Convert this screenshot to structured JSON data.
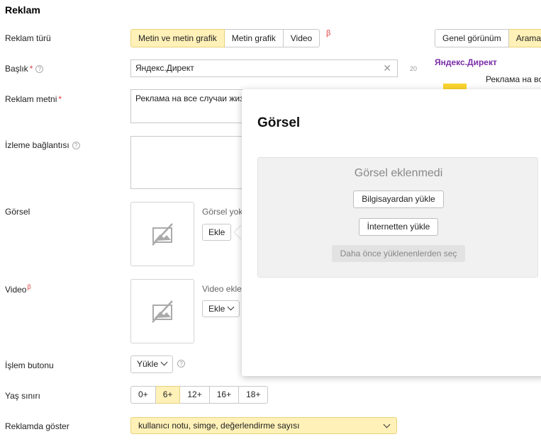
{
  "section": {
    "title": "Reklam"
  },
  "labels": {
    "ad_type": "Reklam türü",
    "title": "Başlık",
    "ad_text": "Reklam metni",
    "tracking": "İzleme bağlantısı",
    "image": "Görsel",
    "video": "Video",
    "action_button": "İşlem butonu",
    "age_limit": "Yaş sınırı",
    "show_in_ad": "Reklamda göster",
    "required_mark": "*",
    "beta_mark": "β",
    "help_mark": "?"
  },
  "ad_type": {
    "options": [
      "Metin ve metin grafik",
      "Metin grafik",
      "Video"
    ],
    "selected": 0
  },
  "title_field": {
    "value": "Яндекс.Директ",
    "counter": "20"
  },
  "text_field": {
    "value": "Реклама на все случаи жизн"
  },
  "image_block": {
    "status": "Görsel yok",
    "add_button": "Ekle"
  },
  "video_block": {
    "status": "Video ekler",
    "add_button": "Ekle"
  },
  "action_button_select": {
    "value": "Yükle"
  },
  "age_limit": {
    "options": [
      "0+",
      "6+",
      "12+",
      "16+",
      "18+"
    ],
    "selected": 1
  },
  "show_in_ad": {
    "value": "kullanıcı notu, simge, değerlendirme sayısı"
  },
  "preview": {
    "tabs": [
      "Genel görünüm",
      "Arama"
    ],
    "selected": 1,
    "brand": "Яндекс.Директ",
    "ad_text": "Реклама на вс"
  },
  "modal": {
    "title": "Görsel",
    "empty_text": "Görsel eklenmedi",
    "upload_computer": "Bilgisayardan yükle",
    "upload_internet": "İnternetten yükle",
    "choose_previous": "Daha önce yüklenenlerden seç"
  },
  "colors": {
    "selected_bg": "#fff1b8",
    "required": "#e03b3b",
    "brand": "#7b2ea8"
  }
}
